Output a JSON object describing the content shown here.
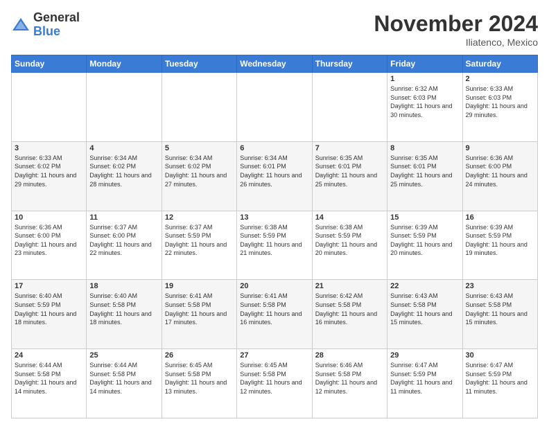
{
  "header": {
    "logo_general": "General",
    "logo_blue": "Blue",
    "month_title": "November 2024",
    "location": "Iliatenco, Mexico"
  },
  "days_of_week": [
    "Sunday",
    "Monday",
    "Tuesday",
    "Wednesday",
    "Thursday",
    "Friday",
    "Saturday"
  ],
  "weeks": [
    [
      {
        "day": "",
        "info": ""
      },
      {
        "day": "",
        "info": ""
      },
      {
        "day": "",
        "info": ""
      },
      {
        "day": "",
        "info": ""
      },
      {
        "day": "",
        "info": ""
      },
      {
        "day": "1",
        "info": "Sunrise: 6:32 AM\nSunset: 6:03 PM\nDaylight: 11 hours and 30 minutes."
      },
      {
        "day": "2",
        "info": "Sunrise: 6:33 AM\nSunset: 6:03 PM\nDaylight: 11 hours and 29 minutes."
      }
    ],
    [
      {
        "day": "3",
        "info": "Sunrise: 6:33 AM\nSunset: 6:02 PM\nDaylight: 11 hours and 29 minutes."
      },
      {
        "day": "4",
        "info": "Sunrise: 6:34 AM\nSunset: 6:02 PM\nDaylight: 11 hours and 28 minutes."
      },
      {
        "day": "5",
        "info": "Sunrise: 6:34 AM\nSunset: 6:02 PM\nDaylight: 11 hours and 27 minutes."
      },
      {
        "day": "6",
        "info": "Sunrise: 6:34 AM\nSunset: 6:01 PM\nDaylight: 11 hours and 26 minutes."
      },
      {
        "day": "7",
        "info": "Sunrise: 6:35 AM\nSunset: 6:01 PM\nDaylight: 11 hours and 25 minutes."
      },
      {
        "day": "8",
        "info": "Sunrise: 6:35 AM\nSunset: 6:01 PM\nDaylight: 11 hours and 25 minutes."
      },
      {
        "day": "9",
        "info": "Sunrise: 6:36 AM\nSunset: 6:00 PM\nDaylight: 11 hours and 24 minutes."
      }
    ],
    [
      {
        "day": "10",
        "info": "Sunrise: 6:36 AM\nSunset: 6:00 PM\nDaylight: 11 hours and 23 minutes."
      },
      {
        "day": "11",
        "info": "Sunrise: 6:37 AM\nSunset: 6:00 PM\nDaylight: 11 hours and 22 minutes."
      },
      {
        "day": "12",
        "info": "Sunrise: 6:37 AM\nSunset: 5:59 PM\nDaylight: 11 hours and 22 minutes."
      },
      {
        "day": "13",
        "info": "Sunrise: 6:38 AM\nSunset: 5:59 PM\nDaylight: 11 hours and 21 minutes."
      },
      {
        "day": "14",
        "info": "Sunrise: 6:38 AM\nSunset: 5:59 PM\nDaylight: 11 hours and 20 minutes."
      },
      {
        "day": "15",
        "info": "Sunrise: 6:39 AM\nSunset: 5:59 PM\nDaylight: 11 hours and 20 minutes."
      },
      {
        "day": "16",
        "info": "Sunrise: 6:39 AM\nSunset: 5:59 PM\nDaylight: 11 hours and 19 minutes."
      }
    ],
    [
      {
        "day": "17",
        "info": "Sunrise: 6:40 AM\nSunset: 5:59 PM\nDaylight: 11 hours and 18 minutes."
      },
      {
        "day": "18",
        "info": "Sunrise: 6:40 AM\nSunset: 5:58 PM\nDaylight: 11 hours and 18 minutes."
      },
      {
        "day": "19",
        "info": "Sunrise: 6:41 AM\nSunset: 5:58 PM\nDaylight: 11 hours and 17 minutes."
      },
      {
        "day": "20",
        "info": "Sunrise: 6:41 AM\nSunset: 5:58 PM\nDaylight: 11 hours and 16 minutes."
      },
      {
        "day": "21",
        "info": "Sunrise: 6:42 AM\nSunset: 5:58 PM\nDaylight: 11 hours and 16 minutes."
      },
      {
        "day": "22",
        "info": "Sunrise: 6:43 AM\nSunset: 5:58 PM\nDaylight: 11 hours and 15 minutes."
      },
      {
        "day": "23",
        "info": "Sunrise: 6:43 AM\nSunset: 5:58 PM\nDaylight: 11 hours and 15 minutes."
      }
    ],
    [
      {
        "day": "24",
        "info": "Sunrise: 6:44 AM\nSunset: 5:58 PM\nDaylight: 11 hours and 14 minutes."
      },
      {
        "day": "25",
        "info": "Sunrise: 6:44 AM\nSunset: 5:58 PM\nDaylight: 11 hours and 14 minutes."
      },
      {
        "day": "26",
        "info": "Sunrise: 6:45 AM\nSunset: 5:58 PM\nDaylight: 11 hours and 13 minutes."
      },
      {
        "day": "27",
        "info": "Sunrise: 6:45 AM\nSunset: 5:58 PM\nDaylight: 11 hours and 12 minutes."
      },
      {
        "day": "28",
        "info": "Sunrise: 6:46 AM\nSunset: 5:58 PM\nDaylight: 11 hours and 12 minutes."
      },
      {
        "day": "29",
        "info": "Sunrise: 6:47 AM\nSunset: 5:59 PM\nDaylight: 11 hours and 11 minutes."
      },
      {
        "day": "30",
        "info": "Sunrise: 6:47 AM\nSunset: 5:59 PM\nDaylight: 11 hours and 11 minutes."
      }
    ]
  ]
}
